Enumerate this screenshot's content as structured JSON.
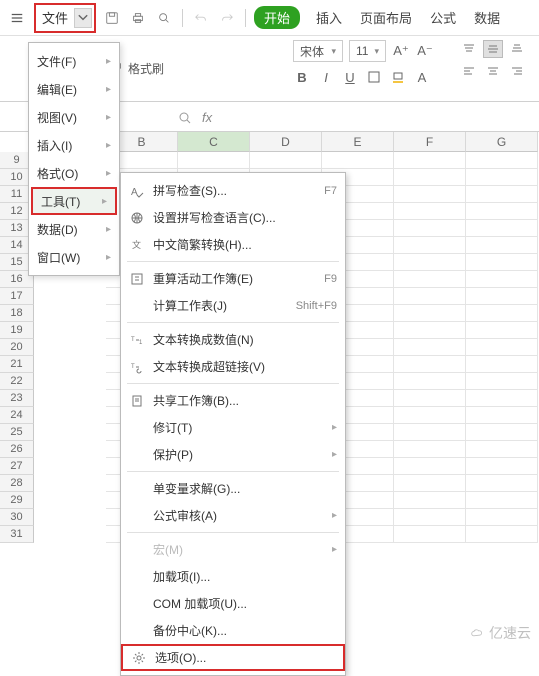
{
  "topbar": {
    "file_label": "文件",
    "start_label": "开始",
    "tabs": [
      "插入",
      "页面布局",
      "公式",
      "数据"
    ]
  },
  "ribbon": {
    "format_brush": "格式刷",
    "font_name": "宋体",
    "font_size": "11"
  },
  "file_menu": {
    "items": [
      {
        "label": "文件(F)",
        "has_sub": true
      },
      {
        "label": "编辑(E)",
        "has_sub": true
      },
      {
        "label": "视图(V)",
        "has_sub": true
      },
      {
        "label": "插入(I)",
        "has_sub": true
      },
      {
        "label": "格式(O)",
        "has_sub": true
      },
      {
        "label": "工具(T)",
        "has_sub": true,
        "hovered": true,
        "boxed": true
      },
      {
        "label": "数据(D)",
        "has_sub": true
      },
      {
        "label": "窗口(W)",
        "has_sub": true
      }
    ]
  },
  "tools_menu": {
    "items": [
      {
        "icon": "spell",
        "label": "拼写检查(S)...",
        "shortcut": "F7"
      },
      {
        "icon": "globe",
        "label": "设置拼写检查语言(C)..."
      },
      {
        "icon": "convert",
        "label": "中文简繁转换(H)..."
      },
      {
        "sep": true
      },
      {
        "icon": "recalc",
        "label": "重算活动工作簿(E)",
        "shortcut": "F9"
      },
      {
        "icon": "",
        "label": "计算工作表(J)",
        "shortcut": "Shift+F9"
      },
      {
        "sep": true
      },
      {
        "icon": "text2num",
        "label": "文本转换成数值(N)"
      },
      {
        "icon": "text2link",
        "label": "文本转换成超链接(V)"
      },
      {
        "sep": true
      },
      {
        "icon": "share",
        "label": "共享工作簿(B)..."
      },
      {
        "icon": "",
        "label": "修订(T)",
        "has_sub": true
      },
      {
        "icon": "",
        "label": "保护(P)",
        "has_sub": true
      },
      {
        "sep": true
      },
      {
        "icon": "",
        "label": "单变量求解(G)..."
      },
      {
        "icon": "",
        "label": "公式审核(A)",
        "has_sub": true
      },
      {
        "sep": true
      },
      {
        "icon": "",
        "label": "宏(M)",
        "disabled": true,
        "has_sub": true
      },
      {
        "icon": "",
        "label": "加载项(I)..."
      },
      {
        "icon": "",
        "label": "COM 加载项(U)..."
      },
      {
        "icon": "",
        "label": "备份中心(K)..."
      },
      {
        "icon": "gear",
        "label": "选项(O)...",
        "boxed": true
      }
    ]
  },
  "columns": [
    "B",
    "C",
    "D",
    "E",
    "F",
    "G"
  ],
  "selected_col": "C",
  "row_start": 9,
  "row_end": 31,
  "watermark": "亿速云"
}
